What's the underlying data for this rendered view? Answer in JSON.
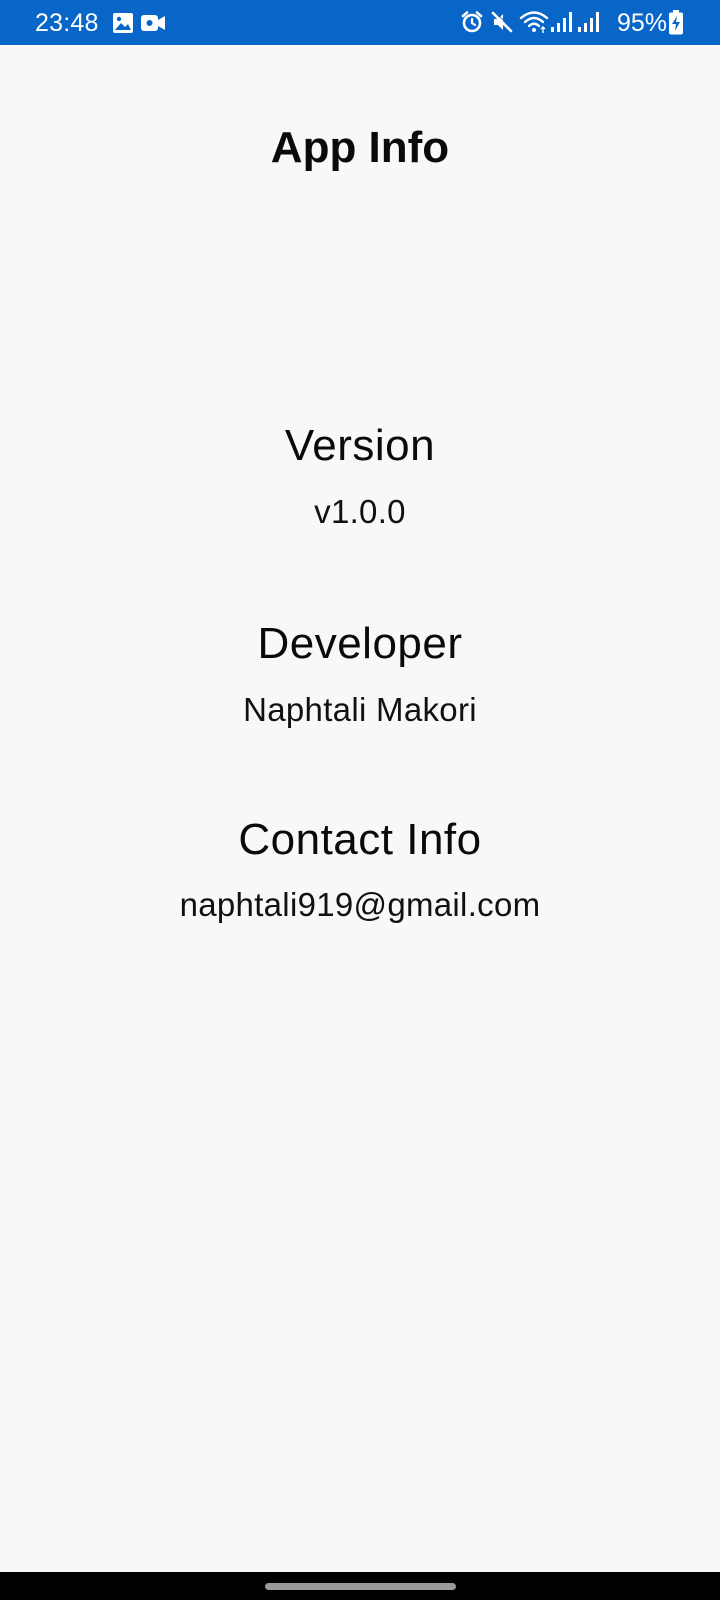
{
  "status_bar": {
    "time": "23:48",
    "battery": "95%",
    "background": "#0866c9",
    "icons": [
      "image-icon",
      "video-camera-icon",
      "alarm-icon",
      "mute-icon",
      "wifi-icon",
      "signal-icon",
      "signal-icon",
      "battery-charging-icon"
    ]
  },
  "page": {
    "title": "App Info"
  },
  "sections": [
    {
      "heading": "Version",
      "value": "v1.0.0"
    },
    {
      "heading": "Developer",
      "value": "Naphtali Makori"
    },
    {
      "heading": "Contact Info",
      "value": "naphtali919@gmail.com"
    }
  ],
  "nav_bar": {
    "handle": "home-indicator"
  }
}
